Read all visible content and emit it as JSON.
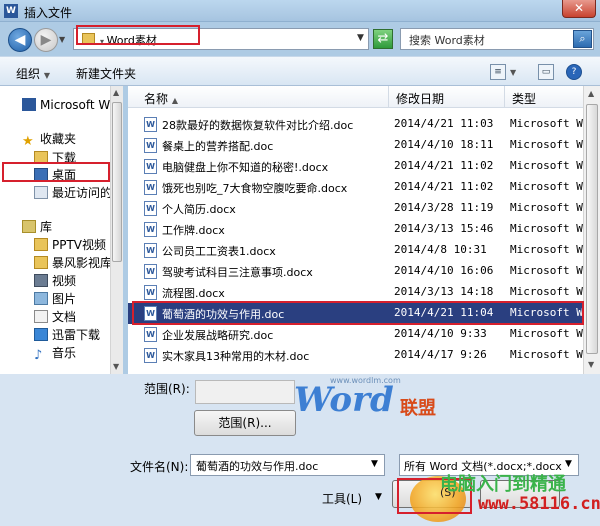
{
  "window": {
    "title": "插入文件",
    "app_icon": "W"
  },
  "nav": {
    "address": "Word素材",
    "search_placeholder": "搜索 Word素材"
  },
  "toolbar": {
    "organize": "组织",
    "new_folder": "新建文件夹"
  },
  "sidebar": {
    "items": [
      {
        "label": "Microsoft Wo",
        "icon": "word-icon"
      },
      {
        "label": "收藏夹",
        "icon": "star-icon"
      },
      {
        "label": "下载",
        "icon": "download-folder-icon"
      },
      {
        "label": "桌面",
        "icon": "desktop-icon"
      },
      {
        "label": "最近访问的",
        "icon": "recent-icon"
      },
      {
        "label": "库",
        "icon": "library-icon"
      },
      {
        "label": "PPTV视频",
        "icon": "folder-icon"
      },
      {
        "label": "暴风影视库",
        "icon": "folder-icon"
      },
      {
        "label": "视频",
        "icon": "video-icon"
      },
      {
        "label": "图片",
        "icon": "picture-icon"
      },
      {
        "label": "文档",
        "icon": "document-icon"
      },
      {
        "label": "迅雷下载",
        "icon": "download-icon"
      },
      {
        "label": "音乐",
        "icon": "music-icon"
      }
    ]
  },
  "list": {
    "columns": {
      "name": "名称",
      "date": "修改日期",
      "type": "类型"
    },
    "rows": [
      {
        "name": "28款最好的数据恢复软件对比介绍.doc",
        "date": "2014/4/21 11:03",
        "type": "Microsoft Wo"
      },
      {
        "name": "餐桌上的营养搭配.doc",
        "date": "2014/4/10 18:11",
        "type": "Microsoft Wo"
      },
      {
        "name": "电脑健盘上你不知道的秘密!.docx",
        "date": "2014/4/21 11:02",
        "type": "Microsoft Wo"
      },
      {
        "name": "饿死也别吃_7大食物空腹吃要命.docx",
        "date": "2014/4/21 11:02",
        "type": "Microsoft Wo"
      },
      {
        "name": "个人简历.docx",
        "date": "2014/3/28 11:19",
        "type": "Microsoft Wo"
      },
      {
        "name": "工作牌.docx",
        "date": "2014/3/13 15:46",
        "type": "Microsoft Wo"
      },
      {
        "name": "公司员工工资表1.docx",
        "date": "2014/4/8 10:31",
        "type": "Microsoft Wo"
      },
      {
        "name": "驾驶考试科目三注意事项.docx",
        "date": "2014/4/10 16:06",
        "type": "Microsoft Wo"
      },
      {
        "name": "流程图.docx",
        "date": "2014/3/13 14:18",
        "type": "Microsoft Wo"
      },
      {
        "name": "葡萄酒的功效与作用.doc",
        "date": "2014/4/21 11:04",
        "type": "Microsoft Wo",
        "selected": true
      },
      {
        "name": "企业发展战略研究.doc",
        "date": "2014/4/10 9:33",
        "type": "Microsoft Wo"
      },
      {
        "name": "实木家具13种常用的木材.doc",
        "date": "2014/4/17 9:26",
        "type": "Microsoft Wo"
      }
    ]
  },
  "range": {
    "label": "范围(R):",
    "button": "范围(R)..."
  },
  "filename": {
    "label": "文件名(N):",
    "value": "葡萄酒的功效与作用.doc"
  },
  "filetype": {
    "value": "所有 Word 文档(*.docx;*.docx"
  },
  "footer": {
    "tools": "工具(L)",
    "insert": "(S)"
  },
  "watermarks": {
    "brand_word": "Word",
    "brand_union": "联盟",
    "brand_site": "www.wordlm.com",
    "site_cn": "电脑入门到精通",
    "site_url": "www.58116.cn"
  }
}
